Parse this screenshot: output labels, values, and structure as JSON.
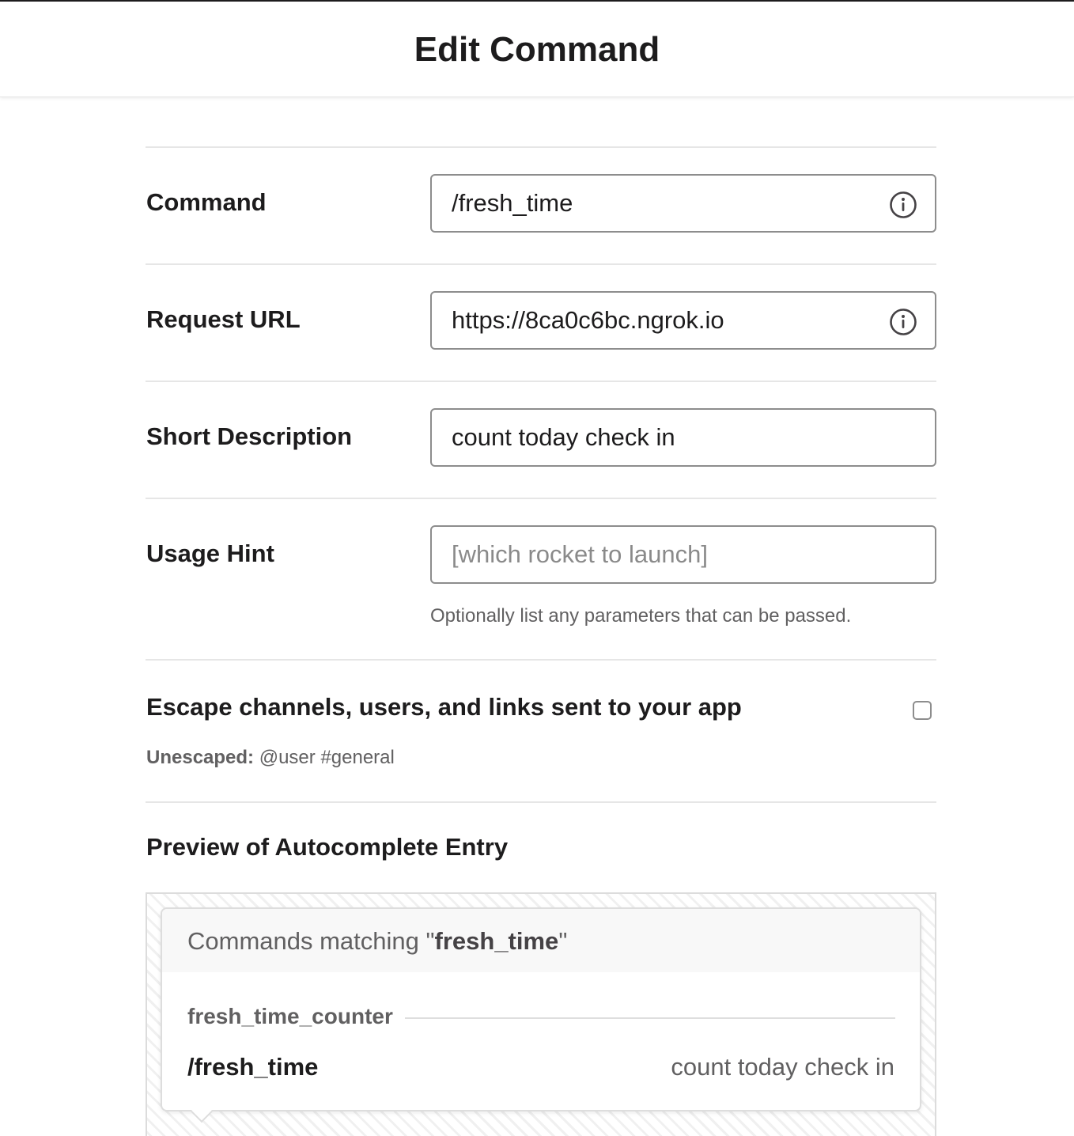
{
  "page": {
    "title": "Edit Command"
  },
  "form": {
    "command": {
      "label": "Command",
      "value": "/fresh_time"
    },
    "request_url": {
      "label": "Request URL",
      "value": "https://8ca0c6bc.ngrok.io"
    },
    "short_description": {
      "label": "Short Description",
      "value": "count today check in"
    },
    "usage_hint": {
      "label": "Usage Hint",
      "placeholder": "[which rocket to launch]",
      "help": "Optionally list any parameters that can be passed."
    },
    "escape": {
      "label": "Escape channels, users, and links sent to your app",
      "checked": false,
      "example_label": "Unescaped:",
      "example_value": "@user #general"
    }
  },
  "preview": {
    "title": "Preview of Autocomplete Entry",
    "header_prefix": "Commands matching \"",
    "header_query": "fresh_time",
    "header_suffix": "\"",
    "app_name": "fresh_time_counter",
    "command": "/fresh_time",
    "description": "count today check in"
  },
  "icons": {
    "info": "info-circle-icon"
  },
  "colors": {
    "text": "#1d1c1d",
    "muted": "#616061",
    "border": "#8d8d8d",
    "divider": "#e6e6e6"
  }
}
